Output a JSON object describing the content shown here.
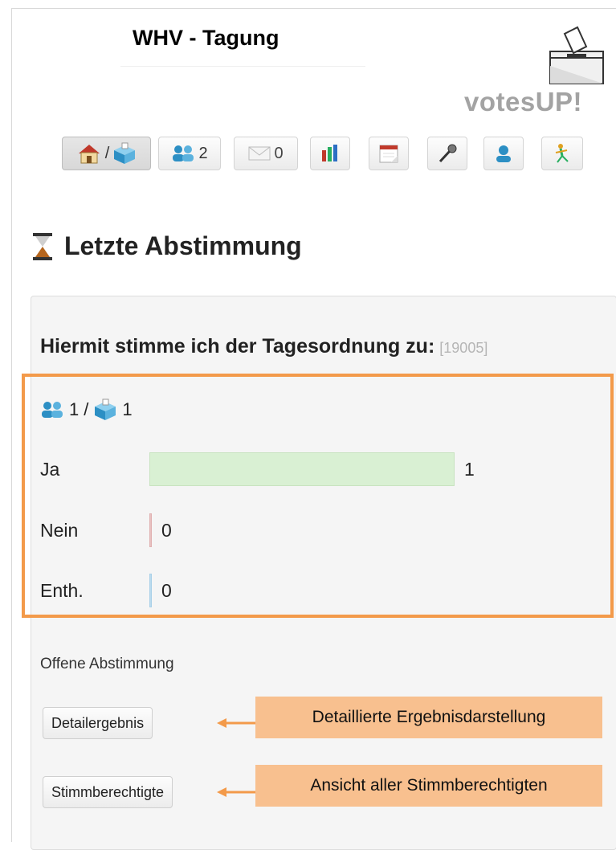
{
  "header": {
    "title": "WHV - Tagung",
    "logo_text": "votesUP!"
  },
  "toolbar": {
    "home_separator": "/",
    "participants_count": "2",
    "messages_count": "0",
    "icons": [
      "home-icon",
      "ballot-box-icon",
      "users-icon",
      "envelope-icon",
      "bar-chart-icon",
      "calendar-icon",
      "microphone-icon",
      "user-icon",
      "exit-icon"
    ]
  },
  "section": {
    "heading": "Letzte Abstimmung",
    "icon": "hourglass-icon"
  },
  "vote": {
    "question": "Hiermit stimme ich der Tagesordnung zu:",
    "id": "[19005]",
    "participants": "1",
    "separator": "/",
    "ballots": "1",
    "options": [
      {
        "label": "Ja",
        "value": "1",
        "share": 1.0,
        "color": "#d9f0d3",
        "border": "#c8e3c0"
      },
      {
        "label": "Nein",
        "value": "0",
        "share": 0.0,
        "color": "#e8c2c2",
        "border": "#e0b0b0"
      },
      {
        "label": "Enth.",
        "value": "0",
        "share": 0.0,
        "color": "#bcdcee",
        "border": "#a9d0e8"
      }
    ],
    "mode": "Offene Abstimmung",
    "detail_button": "Detailergebnis",
    "voters_button": "Stimmberechtigte"
  },
  "annotations": {
    "detail_callout": "Detaillierte Ergebnisdarstellung",
    "voters_callout": "Ansicht aller Stimmberechtigten",
    "highlight_color": "#f39a4a",
    "callout_color": "#f8c08f"
  }
}
